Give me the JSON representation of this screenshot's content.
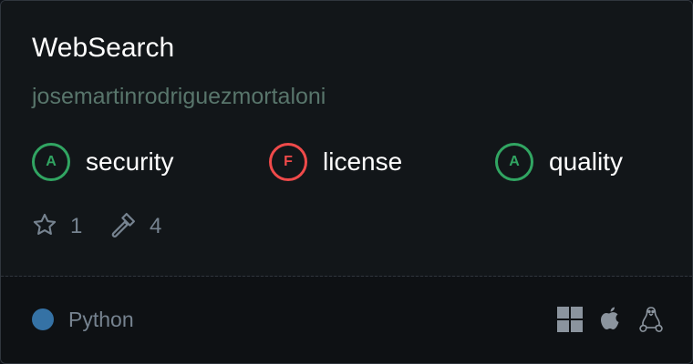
{
  "repo": {
    "name": "WebSearch",
    "owner": "josemartinrodriguezmortaloni"
  },
  "grades": [
    {
      "grade": "A",
      "label": "security",
      "color": "#31a562"
    },
    {
      "grade": "F",
      "label": "license",
      "color": "#ef4a4a"
    },
    {
      "grade": "A",
      "label": "quality",
      "color": "#31a562"
    }
  ],
  "stats": {
    "stars": "1",
    "forks": "4"
  },
  "language": {
    "name": "Python",
    "color": "#3572a5"
  },
  "platforms": [
    "windows-icon",
    "apple-icon",
    "linux-icon"
  ]
}
